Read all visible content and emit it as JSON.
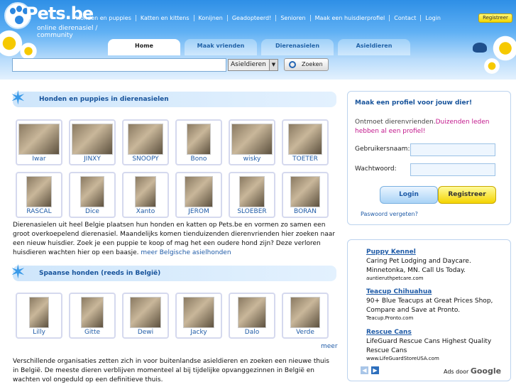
{
  "header": {
    "logo_name": "Pets.be",
    "tagline": "online dierenasiel / community",
    "nav": [
      "Honden en puppies",
      "Katten en kittens",
      "Konijnen",
      "Geadopteerd!",
      "Senioren",
      "Maak een huisdierprofiel",
      "Contact",
      "Login"
    ],
    "register_label": "Registreer"
  },
  "tabs": [
    "Home",
    "Maak vrienden",
    "Dierenasielen",
    "Asieldieren"
  ],
  "search": {
    "value": "",
    "category": "Asieldieren",
    "button": "Zoeken"
  },
  "section1": {
    "title": "Honden en puppies in dierenasielen",
    "dogs": [
      "Iwar",
      "JINXY",
      "SNOOPY",
      "Bono",
      "wisky",
      "TOETER",
      "RASCAL",
      "Dice",
      "Xanto",
      "JEROM",
      "SLOEBER",
      "BORAN"
    ],
    "text": "Dierenasielen uit heel Belgie plaatsen hun honden en katten op Pets.be en vormen zo samen een groot overkoepelend dierenasiel. Maandelijks komen tienduizenden dierenvrienden hier zoeken naar een nieuw huisdier. Zoek je een puppie te koop of mag het een oudere hond zijn? Deze verloren huisdieren wachten hier op een baasje.",
    "link": "meer Belgische asielhonden"
  },
  "section2": {
    "title": "Spaanse honden (reeds in België)",
    "dogs": [
      "Lilly",
      "Gitte",
      "Dewi",
      "Jacky",
      "Dalo",
      "Verde"
    ],
    "more": "meer",
    "text": "Verschillende organisaties zetten zich in voor buitenlandse asieldieren en zoeken een nieuwe thuis in België. De meeste dieren verblijven momenteel al bij tijdelijke opvanggezinnen in België en wachten vol ongeduld op een definitieve thuis."
  },
  "login": {
    "title": "Maak een profiel voor jouw dier!",
    "intro": "Ontmoet dierenvrienden.",
    "intro_highlight": "Duizenden leden hebben al een profiel!",
    "username_label": "Gebruikersnaam:",
    "password_label": "Wachtwoord:",
    "username_value": "",
    "password_value": "",
    "login_button": "Login",
    "register_button": "Registreer",
    "forgot": "Paswoord vergeten?"
  },
  "ads": {
    "items": [
      {
        "title": "Puppy Kennel",
        "desc": "Caring Pet Lodging and Daycare. Minnetonka, MN. Call Us Today.",
        "url": "auntieruthpetcare.com"
      },
      {
        "title": "Teacup Chihuahua",
        "desc": "90+ Blue Teacups at Great Prices Shop, Compare and Save at Pronto.",
        "url": "Teacup.Pronto.com"
      },
      {
        "title": "Rescue Cans",
        "desc": "LifeGuard Rescue Cans Highest Quality Rescue Cans",
        "url": "www.LifeGuardStoreUSA.com"
      }
    ],
    "ads_by": "Ads door",
    "google": "Google"
  },
  "colors": {
    "accent": "#1f5ba7",
    "highlight": "#c2188c",
    "register": "#f4d400",
    "header": "#2e8fe6"
  }
}
